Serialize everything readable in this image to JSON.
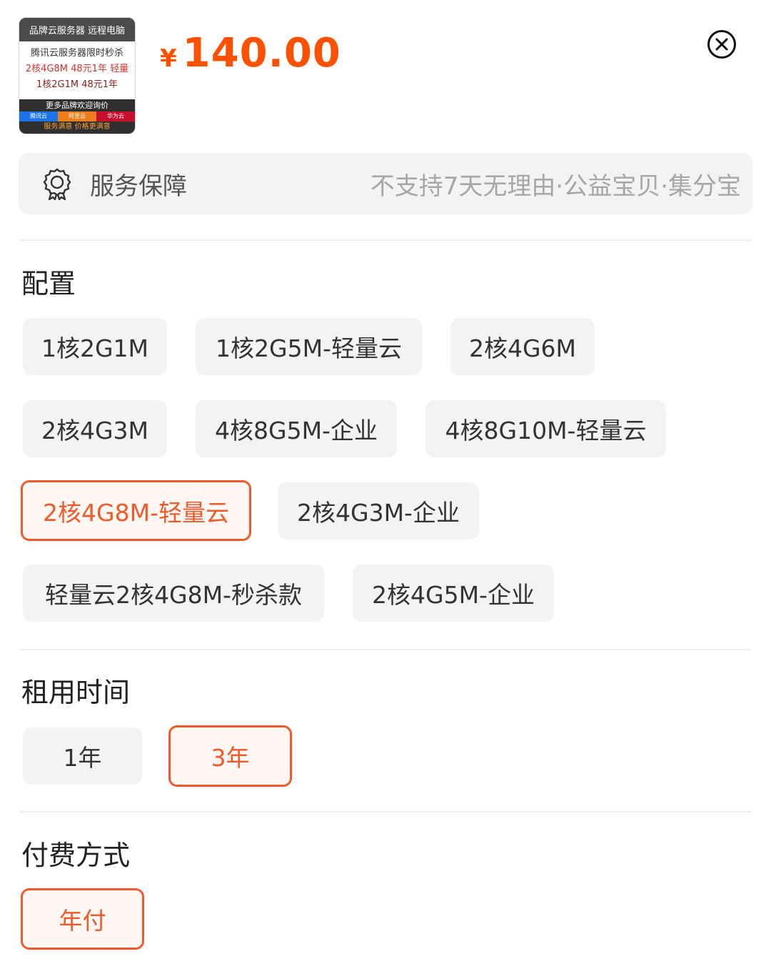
{
  "product_image": {
    "top_text": "品牌云服务器 远程电脑",
    "line1": "腾讯云服务器限时秒杀",
    "line2": "2核4G8M 48元1年 轻量",
    "line3": "1核2G1M 48元1年",
    "bottom_text": "更多品牌欢迎询价",
    "brands": [
      "腾讯云",
      "阿里云",
      "华为云"
    ],
    "bottom_slogan": "服务满意 价格更满意"
  },
  "price": {
    "symbol": "¥",
    "value": "140.00",
    "color": "#ff5000"
  },
  "close_icon": "close-circle-icon",
  "service": {
    "icon": "badge-icon",
    "label": "服务保障",
    "detail": "不支持7天无理由·公益宝贝·集分宝"
  },
  "config": {
    "title": "配置",
    "options": [
      "1核2G1M",
      "1核2G5M-轻量云",
      "2核4G6M",
      "2核4G3M",
      "4核8G5M-企业",
      "4核8G10M-轻量云",
      "2核4G8M-轻量云",
      "2核4G3M-企业",
      "轻量云2核4G8M-秒杀款",
      "2核4G5M-企业"
    ],
    "selected": "2核4G8M-轻量云"
  },
  "rental": {
    "title": "租用时间",
    "options": [
      "1年",
      "3年"
    ],
    "selected": "3年"
  },
  "payment": {
    "title": "付费方式",
    "options": [
      "年付"
    ],
    "selected": "年付"
  },
  "colors": {
    "accent": "#ef5a2a",
    "option_bg": "#f3f3f3"
  }
}
